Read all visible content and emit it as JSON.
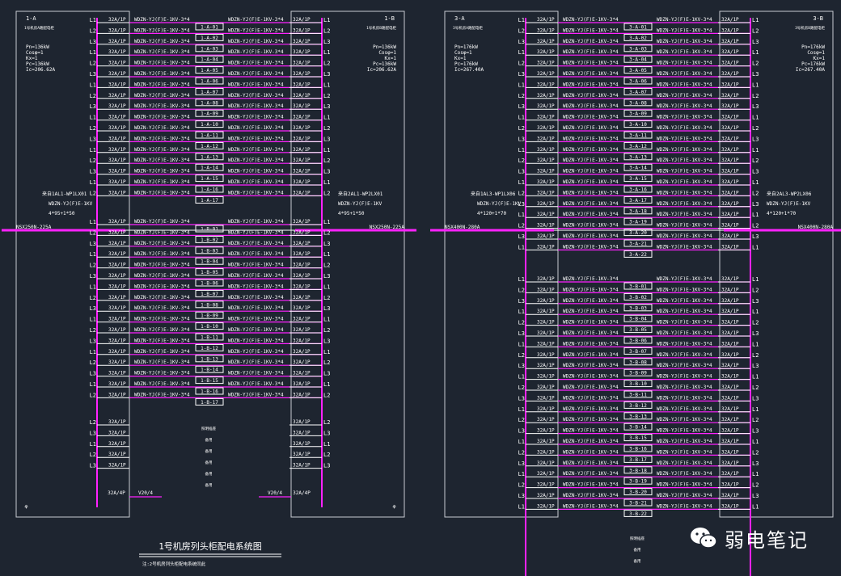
{
  "title": "1号机房列头柜配电系统图",
  "subtitle": "注:2号机房列头柜配电系统同此",
  "watermark": "弱电笔记",
  "colors": {
    "background": "#1e2530",
    "frame": "#c8ccd2",
    "bus": "#ff22ff",
    "line": "#ffffff"
  },
  "cabinet_left": {
    "sections": [
      {
        "left_id": "1-A",
        "left_name": "1号机房A路配电柜",
        "right_id": "1-B",
        "right_name": "1号机房B路配电柜",
        "params_left": [
          "Pn=136kW",
          "Cosφ=1",
          "Kx=1",
          "Pc=136kW",
          "Ic=206.62A"
        ],
        "params_right": [
          "Pn=136kW",
          "Cosφ=1",
          "Kx=1",
          "Pc=136kW",
          "Ic=206.62A"
        ],
        "feed_left": [
          "来自1AL1-WP1LX01",
          "WDZN-YJ(F)E-1KV",
          "4*95+1*50"
        ],
        "feed_right": [
          "来自2AL1-WP2LX01",
          "WDZN-YJ(F)E-1KV",
          "4*95+1*50"
        ],
        "breaker_left": "NSX250N-225A",
        "breaker_right": "NSX250N-225A",
        "group_a_prefix": "1-A-",
        "group_b_prefix": "1-B-",
        "group_a_count": 17,
        "group_b_count": 17,
        "spare_labels": [
          "L2",
          "L3",
          "L1",
          "L2",
          "L3"
        ],
        "aux_notes": [
          "照明插座",
          "备用",
          "备用",
          "备用",
          "备用",
          "备用"
        ],
        "last_breaker": "32A/4P",
        "last_cable": "V20/4",
        "last_cable_right": "V20/4"
      }
    ]
  },
  "cabinet_right": {
    "left_id": "3-A",
    "left_name": "3号机房A路配电柜",
    "right_id": "3-B",
    "right_name": "3号机房B路配电柜",
    "params_left": [
      "Pn=176kW",
      "Cosφ=1",
      "Kx=1",
      "Pc=176kW",
      "Ic=267.40A"
    ],
    "params_right": [
      "Pn=176kW",
      "Cosφ=1",
      "Kx=1",
      "Pc=176kW",
      "Ic=267.40A"
    ],
    "feed_left": [
      "来自1AL3-WP1LX06",
      "WDZN-YJ(F)E-1KV",
      "4*120+1*70"
    ],
    "feed_right": [
      "来自2AL3-WP2LX06",
      "WDZN-YJ(F)E-1KV",
      "4*120+1*70"
    ],
    "breaker_left": "NSX400N-280A",
    "breaker_right": "NSX400N-280A",
    "group_a_prefix": "3-A-",
    "group_b_prefix": "3-B-",
    "group_a_count": 22,
    "group_b_count": 22,
    "aux_notes": [
      "照明插座",
      "备用",
      "备用"
    ]
  },
  "circuit": {
    "breaker": "32A/1P",
    "cable": "WDZN-YJ(F)E-1KV-3*4",
    "phases": [
      "L1",
      "L2",
      "L3"
    ]
  }
}
